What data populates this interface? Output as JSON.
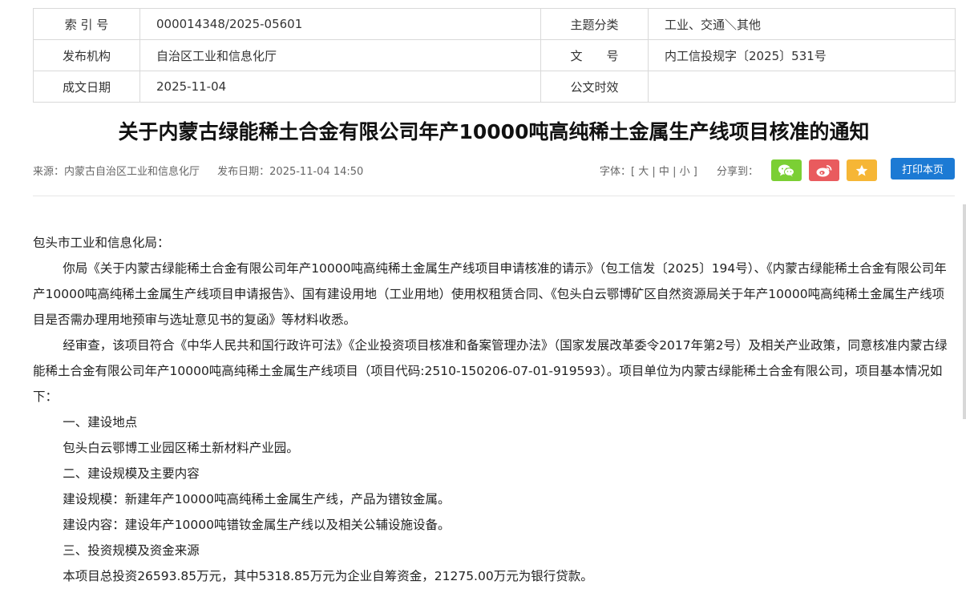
{
  "meta": {
    "row1": {
      "k1": "索 引 号",
      "v1": "000014348/2025-05601",
      "k2": "主题分类",
      "v2": "工业、交通＼其他"
    },
    "row2": {
      "k1": "发布机构",
      "v1": "自治区工业和信息化厅",
      "k2": "文　　号",
      "v2": "内工信投规字〔2025〕531号"
    },
    "row3": {
      "k1": "成文日期",
      "v1": "2025-11-04",
      "k2": "公文时效",
      "v2": ""
    }
  },
  "title": "关于内蒙古绿能稀土合金有限公司年产10000吨高纯稀土金属生产线项目核准的通知",
  "info": {
    "source": "来源：内蒙古自治区工业和信息化厅",
    "publish_date": "发布日期：2025-11-04 14:50"
  },
  "font_size": {
    "label": "字体：",
    "open": "[",
    "large": "大",
    "sep1": "|",
    "medium": "中",
    "sep2": "|",
    "small": "小",
    "close": "]"
  },
  "share_label": "分享到：",
  "share_icons": {
    "wechat": "wechat-icon",
    "weibo": "weibo-icon",
    "favorite": "star-icon"
  },
  "colors": {
    "wechat": "#7bcf34",
    "weibo": "#e95b5e",
    "favorite": "#f6b636",
    "print": "#1c7ad4"
  },
  "print_label": "打印本页",
  "body": {
    "salutation": "包头市工业和信息化局：",
    "p1": "你局《关于内蒙古绿能稀土合金有限公司年产10000吨高纯稀土金属生产线项目申请核准的请示》（包工信发〔2025〕194号）、《内蒙古绿能稀土合金有限公司年产10000吨高纯稀土金属生产线项目申请报告》、国有建设用地（工业用地）使用权租赁合同、《包头白云鄂博矿区自然资源局关于年产10000吨高纯稀土金属生产线项目是否需办理用地预审与选址意见书的复函》等材料收悉。",
    "p2": "经审查，该项目符合《中华人民共和国行政许可法》《企业投资项目核准和备案管理办法》（国家发展改革委令2017年第2号）及相关产业政策，同意核准内蒙古绿能稀土合金有限公司年产10000吨高纯稀土金属生产线项目（项目代码:2510-150206-07-01-919593）。项目单位为内蒙古绿能稀土合金有限公司，项目基本情况如下：",
    "h1": "一、建设地点",
    "p3": "包头白云鄂博工业园区稀土新材料产业园。",
    "h2": "二、建设规模及主要内容",
    "p4": "建设规模：新建年产10000吨高纯稀土金属生产线，产品为镨钕金属。",
    "p5": "建设内容：建设年产10000吨镨钕金属生产线以及相关公辅设施设备。",
    "h3": "三、投资规模及资金来源",
    "p6": "本项目总投资26593.85万元，其中5318.85万元为企业自筹资金，21275.00万元为银行贷款。"
  }
}
